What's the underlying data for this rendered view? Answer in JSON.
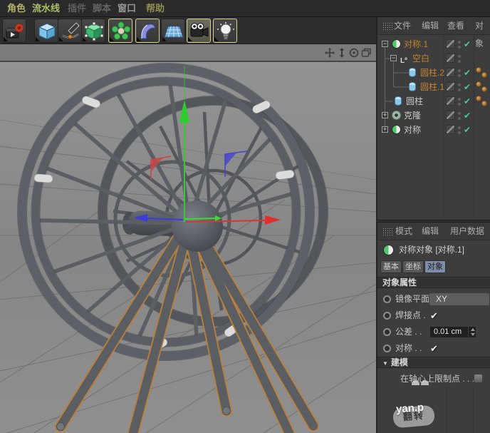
{
  "window": {
    "menu_items": [
      {
        "label": "角色",
        "color": "#b3b36b"
      },
      {
        "label": "流水线",
        "color": "#aabf68"
      },
      {
        "label": "插件",
        "color": "#5f5f5f"
      },
      {
        "label": "脚本",
        "color": "#656565"
      },
      {
        "label": "窗口",
        "color": "#979797"
      },
      {
        "label": "帮助",
        "color": "#90904f"
      }
    ]
  },
  "toolbar": {
    "icons": [
      "render-settings-icon",
      "cube-primitive-icon",
      "pen-spline-icon",
      "editable-object-icon",
      "array-generator-icon",
      "deformer-icon",
      "floor-grid-icon",
      "camera-icon",
      "light-icon"
    ]
  },
  "viewport": {
    "nav_icons": [
      "pan-icon",
      "dolly-icon",
      "rotate-icon",
      "maximize-icon"
    ],
    "axis_colors": {
      "x": "#e03030",
      "y": "#2ecc2e",
      "z": "#3a3ae0"
    },
    "selection_outline_color": "#bd8038"
  },
  "object_manager": {
    "menu": [
      {
        "label": "文件"
      },
      {
        "label": "编辑"
      },
      {
        "label": "查看"
      },
      {
        "label": "对象"
      }
    ],
    "rows": [
      {
        "label": "对称.1",
        "icon": "symmetry-icon",
        "selected": true,
        "enabled": true,
        "tags": 0
      },
      {
        "label": "空白",
        "icon": "null-icon",
        "selected": true,
        "enabled": null,
        "tags": 0
      },
      {
        "label": "圆柱.2",
        "icon": "cylinder-icon",
        "selected": true,
        "enabled": true,
        "tags": 2
      },
      {
        "label": "圆柱.1",
        "icon": "cylinder-icon",
        "selected": true,
        "enabled": true,
        "tags": 2
      },
      {
        "label": "圆柱",
        "icon": "cylinder-icon",
        "selected": false,
        "enabled": true,
        "tags": 2
      },
      {
        "label": "克隆",
        "icon": "cloner-icon",
        "selected": false,
        "enabled": true,
        "tags": 0
      },
      {
        "label": "对称",
        "icon": "symmetry-icon",
        "selected": false,
        "enabled": true,
        "tags": 0
      }
    ]
  },
  "attribute_manager": {
    "menu": [
      {
        "label": "模式"
      },
      {
        "label": "编辑"
      },
      {
        "label": "用户数据"
      }
    ],
    "object_title": "对称对象 [对称.1]",
    "tabs": [
      {
        "label": "基本"
      },
      {
        "label": "坐标"
      },
      {
        "label": "对象"
      }
    ],
    "active_tab": "对象",
    "properties_header": "对象属性",
    "mirror_plane": {
      "label": "镜像平面",
      "value": "XY"
    },
    "weld_points": {
      "label": "焊接点 .",
      "checked": true
    },
    "tolerance": {
      "label": "公差 . .",
      "value": "0.01 cm"
    },
    "symmetric": {
      "label": "对称 . .",
      "checked": true
    },
    "modeling_header": "建模",
    "clamp_points": {
      "label": "在轴心上限制点 . . .",
      "checked": false
    },
    "flip_label": "翻转"
  },
  "watermark": {
    "text": "yan.p"
  }
}
